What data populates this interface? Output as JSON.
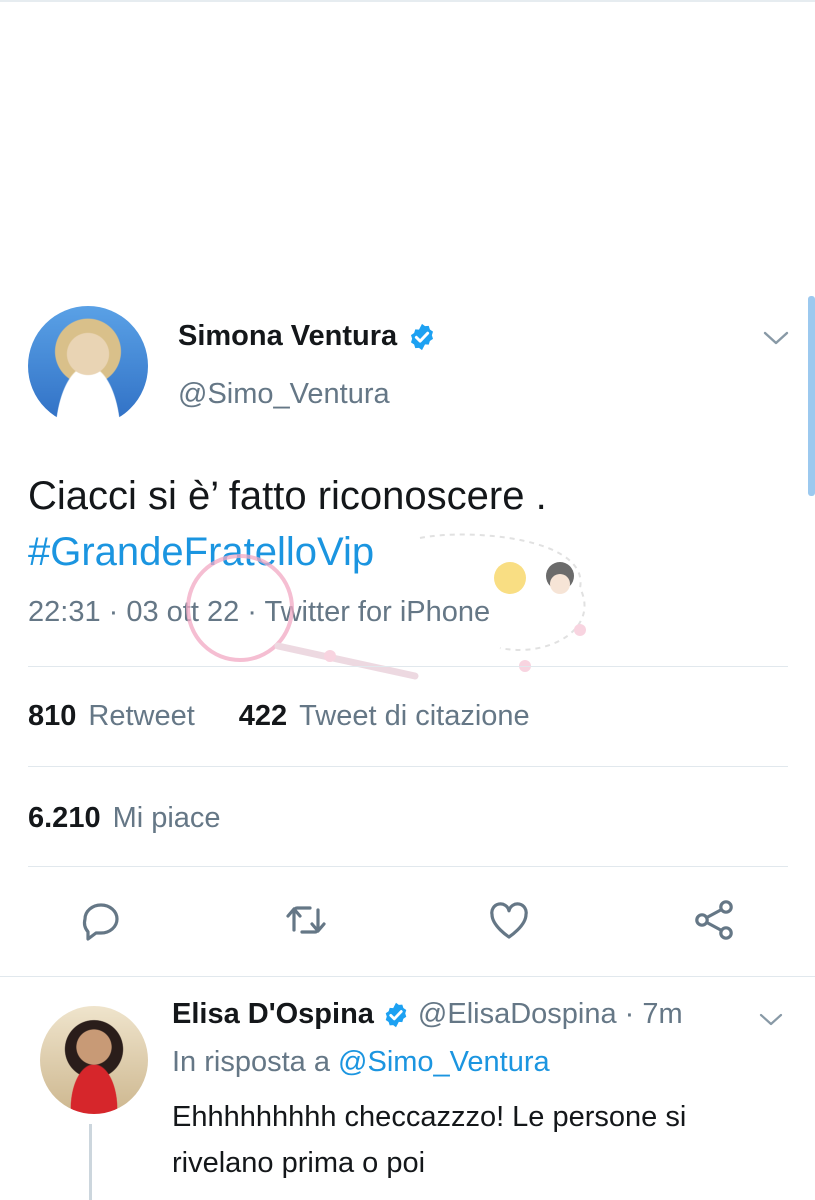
{
  "tweet": {
    "author_name": "Simona Ventura",
    "author_handle": "@Simo_Ventura",
    "text": "Ciacci si è’ fatto riconoscere .",
    "hashtag": "#GrandeFratelloVip",
    "meta": "22:31 · 03 ott 22 · Twitter for iPhone",
    "stats": {
      "retweets_count": "810",
      "retweets_label": "Retweet",
      "quotes_count": "422",
      "quotes_label": "Tweet di citazione",
      "likes_count": "6.210",
      "likes_label": "Mi piace"
    },
    "actions": [
      "reply-icon",
      "retweet-icon",
      "like-icon",
      "share-icon"
    ]
  },
  "reply": {
    "author_name": "Elisa D'Ospina",
    "author_handle": "@ElisaDospina",
    "time": "· 7m",
    "in_reply_prefix": "In risposta a",
    "in_reply_mention": "@Simo_Ventura",
    "text": "Ehhhhhhhhh checcazzzo! Le persone si rivelano prima o poi"
  },
  "colors": {
    "link": "#1b95e0",
    "secondary_text": "#657786",
    "primary_text": "#14171a",
    "verified": "#1da1f2"
  }
}
